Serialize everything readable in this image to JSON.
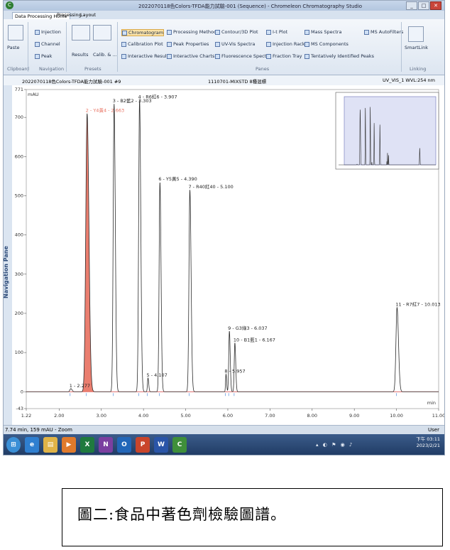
{
  "window": {
    "title": "2022070118色Colors-TFDA能力試驗-001 (Sequence) - Chromeleon Chromatography Studio",
    "app_icon": "chromeleon-icon",
    "buttons": [
      "_",
      "□",
      "✕"
    ]
  },
  "tabs": [
    "Data Processing Home",
    "Processing",
    "Layout"
  ],
  "ribbon": {
    "clipboard": {
      "paste": "Paste",
      "group": "Clipboard"
    },
    "navigation": {
      "injection": "Injection",
      "channel": "Channel",
      "peak": "Peak",
      "group": "Navigation"
    },
    "presets": {
      "results": "Results",
      "calib": "Calib. & ...",
      "group": "Presets"
    },
    "panes": {
      "col1": [
        "Chromatogram",
        "Calibration Plot",
        "Interactive Results"
      ],
      "col2": [
        "Processing Method",
        "Peak Properties",
        "Interactive Charts"
      ],
      "col3": [
        "Contour/3D Plot",
        "UV-Vis Spectra",
        "Fluorescence Spectra"
      ],
      "col4": [
        "I-t Plot",
        "Injection Rack",
        "Fraction Tray"
      ],
      "col5": [
        "Mass Spectra",
        "MS Components",
        "Tentatively Identified Peaks"
      ],
      "col6": [
        "MS AutoFilters"
      ],
      "group": "Panes"
    },
    "linking": {
      "smartlink": "SmartLink",
      "group": "Linking"
    }
  },
  "docbar": {
    "left": "2022070118色Colors-TFDA能力試驗-001 #9",
    "center": "1110701-MIXSTD 8種混標",
    "right": "UV_VIS_1 WVL:254 nm"
  },
  "nav_pane_label": "Navigation Pane",
  "chart_data": {
    "type": "line",
    "ylabel": "mAU",
    "xlabel": "min",
    "ylim": [
      -43,
      771
    ],
    "xlim": [
      1.22,
      11.0
    ],
    "ytick_labels": [
      "-43",
      "0",
      "100",
      "200",
      "300",
      "400",
      "500",
      "600",
      "700",
      "771"
    ],
    "yticks": [
      -43,
      0,
      100,
      200,
      300,
      400,
      500,
      600,
      700,
      771
    ],
    "xtick_labels": [
      "1.22",
      "2.00",
      "3.00",
      "4.00",
      "5.00",
      "6.00",
      "7.00",
      "8.00",
      "9.00",
      "10.00",
      "11.00"
    ],
    "xticks": [
      1.22,
      2.0,
      3.0,
      4.0,
      5.0,
      6.0,
      7.0,
      8.0,
      9.0,
      10.0,
      11.0
    ],
    "peaks": [
      {
        "label": "1 - 2.277",
        "rt": 2.277,
        "height": 8,
        "width": 0.05,
        "highlight": false
      },
      {
        "label": "2 - Y4黃4 - 2.663",
        "rt": 2.663,
        "height": 710,
        "width": 0.075,
        "highlight": true
      },
      {
        "label": "3 - B2藍2 - 3.303",
        "rt": 3.303,
        "height": 735,
        "width": 0.05,
        "highlight": false
      },
      {
        "label": "4 - R6紅6 - 3.907",
        "rt": 3.907,
        "height": 745,
        "width": 0.05,
        "highlight": false
      },
      {
        "label": "5 - 4.107",
        "rt": 4.107,
        "height": 35,
        "width": 0.03,
        "highlight": false
      },
      {
        "label": "6 - Y5黃5 - 4.390",
        "rt": 4.39,
        "height": 535,
        "width": 0.045,
        "highlight": false
      },
      {
        "label": "7 - R40紅40 - 5.100",
        "rt": 5.1,
        "height": 515,
        "width": 0.05,
        "highlight": false
      },
      {
        "label": "8 - 5.957",
        "rt": 5.957,
        "height": 45,
        "width": 0.025,
        "highlight": false
      },
      {
        "label": "9 - G3綠3 - 6.037",
        "rt": 6.037,
        "height": 155,
        "width": 0.035,
        "highlight": false
      },
      {
        "label": "10 - B1藍1 - 6.167",
        "rt": 6.167,
        "height": 125,
        "width": 0.035,
        "highlight": false
      },
      {
        "label": "11 - R7紅7 - 10.013",
        "rt": 10.013,
        "height": 215,
        "width": 0.06,
        "highlight": false
      }
    ],
    "colors": {
      "trace": "#2b2b2b",
      "highlight": "#e8705f",
      "baseline": "#d23a3a",
      "marker": "#3a7bd5"
    }
  },
  "status": {
    "left": "7.74 min, 159 mAU - Zoom",
    "right": "User"
  },
  "taskbar": {
    "apps": [
      "windows-start-icon",
      "ie-icon",
      "folder-icon",
      "media-icon",
      "excel-icon",
      "onenote-icon",
      "outlook-icon",
      "powerpoint-icon",
      "word-icon",
      "chromeleon-icon"
    ],
    "clock_time": "下午 03:11",
    "clock_date": "2023/2/21"
  },
  "caption": "圖二:食品中著色劑檢驗圖譜。"
}
